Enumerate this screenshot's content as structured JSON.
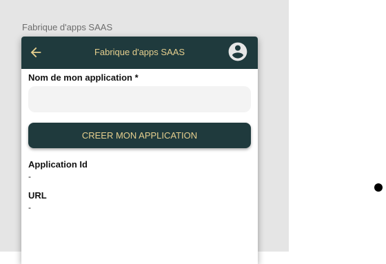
{
  "page": {
    "caption": "Fabrique d'apps SAAS"
  },
  "appbar": {
    "title": "Fabrique d'apps SAAS",
    "back_icon": "arrow-left-icon",
    "account_icon": "account-circle-icon"
  },
  "form": {
    "app_name_label": "Nom de mon application *",
    "app_name_value": "",
    "create_button_label": "CREER MON APPLICATION"
  },
  "info": {
    "app_id_label": "Application Id",
    "app_id_value": "-",
    "url_label": "URL",
    "url_value": "-"
  },
  "colors": {
    "appbar_bg": "#1f3a3d",
    "accent_text": "#e6cf8e",
    "input_bg": "#f3f3f3",
    "pane_bg": "#e5e5e5"
  }
}
